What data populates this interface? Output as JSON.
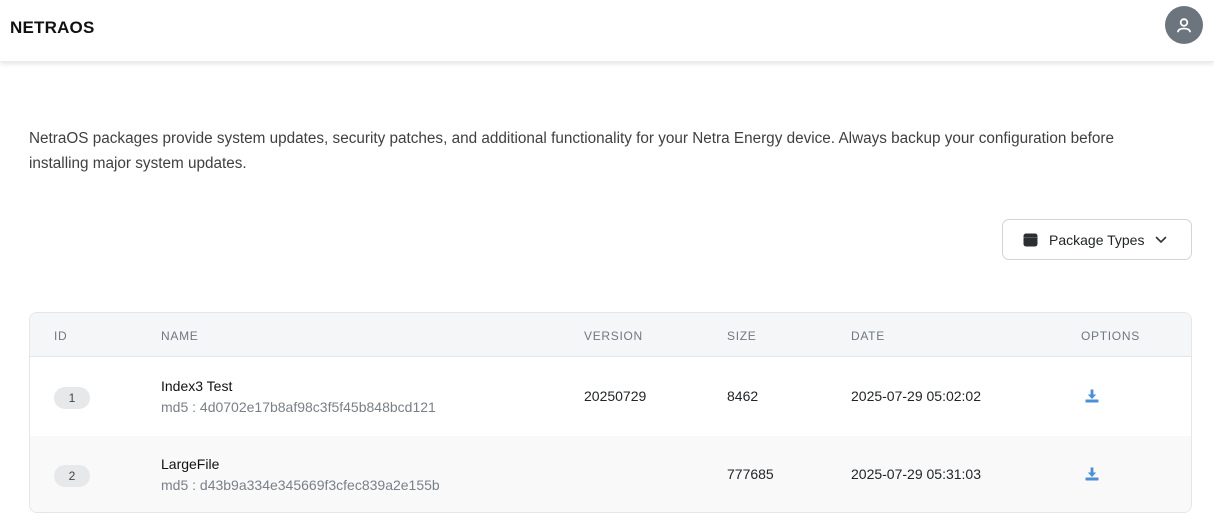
{
  "header": {
    "brand": "NETRAOS",
    "avatar_icon": "user-icon"
  },
  "description": "NetraOS packages provide system updates, security patches, and additional functionality for your Netra Energy device. Always backup your configuration before installing major system updates.",
  "filter": {
    "label": "Package Types",
    "icon": "package-icon",
    "chevron": "chevron-down-icon"
  },
  "table": {
    "columns": [
      "ID",
      "NAME",
      "VERSION",
      "SIZE",
      "DATE",
      "OPTIONS"
    ],
    "rows": [
      {
        "id": "1",
        "name": "Index3 Test",
        "md5": "md5 : 4d0702e17b8af98c3f5f45b848bcd121",
        "version": "20250729",
        "size": "8462",
        "date": "2025-07-29 05:02:02",
        "option_icon": "download-icon"
      },
      {
        "id": "2",
        "name": "LargeFile",
        "md5": "md5 : d43b9a334e345669f3cfec839a2e155b",
        "version": "",
        "size": "777685",
        "date": "2025-07-29 05:31:03",
        "option_icon": "download-icon"
      }
    ]
  },
  "colors": {
    "accent_download": "#4a90d9",
    "avatar_bg": "#6c757d"
  }
}
